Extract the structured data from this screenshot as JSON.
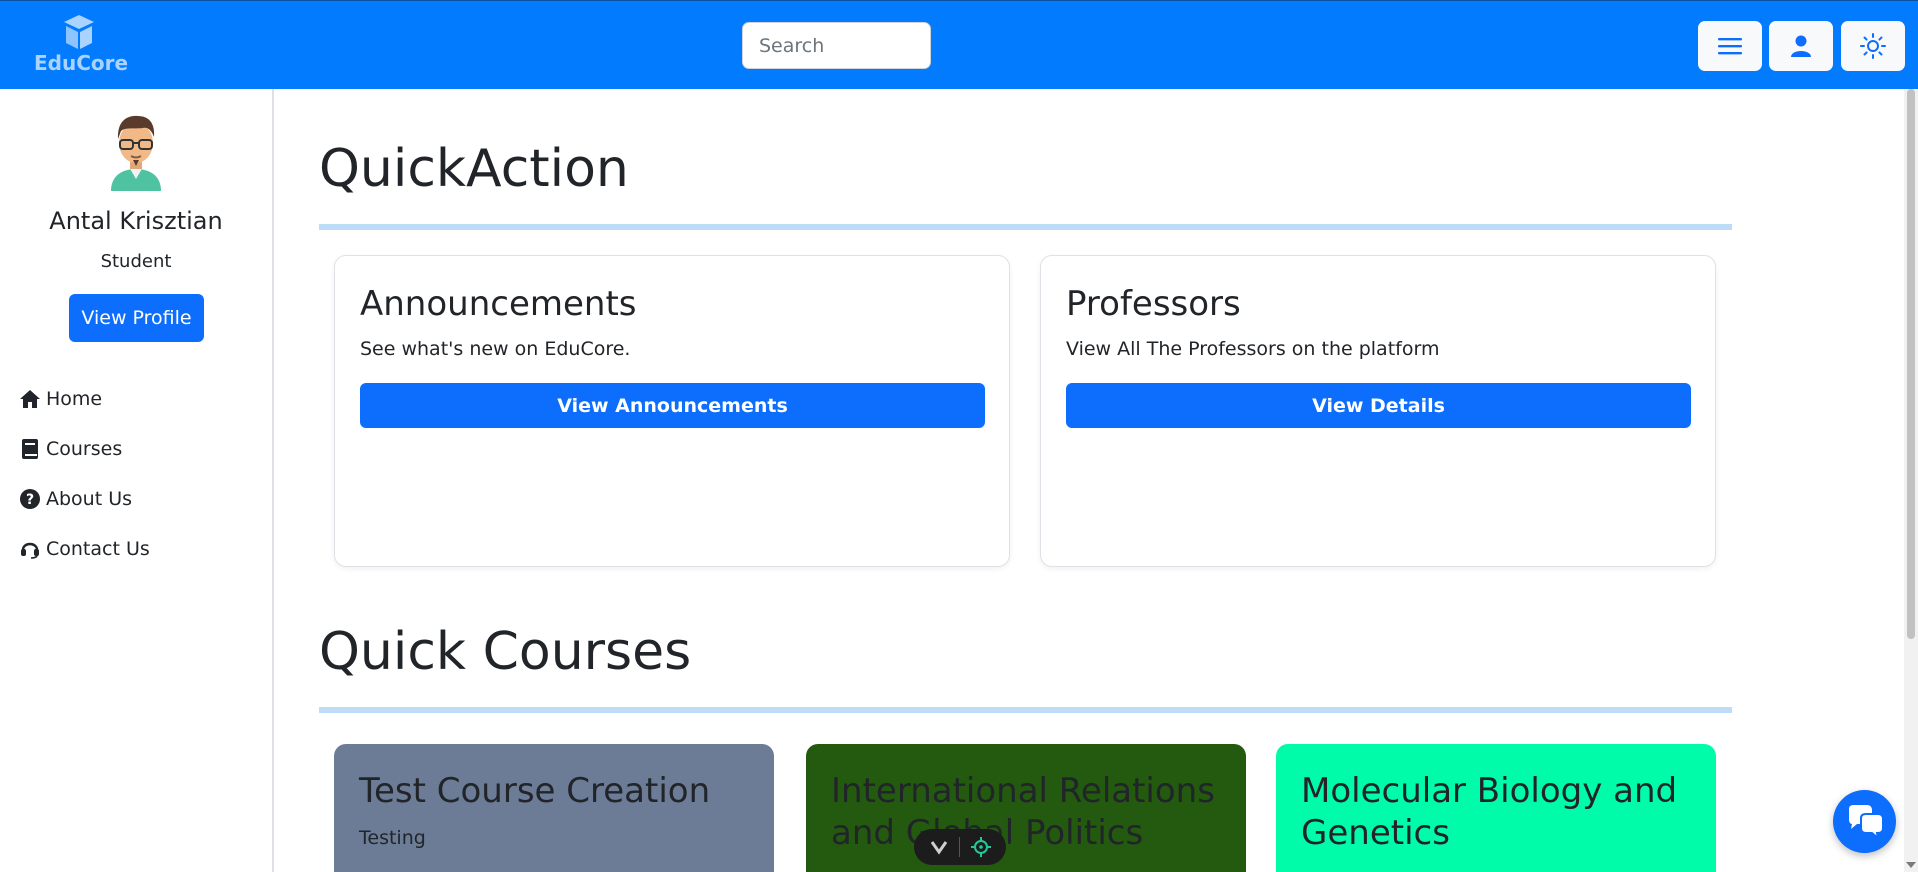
{
  "brand": {
    "name": "EduCore",
    "logo_icon": "graduation-cube-icon"
  },
  "header": {
    "search_placeholder": "Search",
    "buttons": [
      {
        "name": "menu-button",
        "icon": "hamburger-icon"
      },
      {
        "name": "user-button",
        "icon": "user-icon"
      },
      {
        "name": "theme-button",
        "icon": "sun-icon"
      }
    ]
  },
  "sidebar": {
    "user_name": "Antal Krisztian",
    "user_role": "Student",
    "view_profile_label": "View Profile",
    "nav": [
      {
        "label": "Home",
        "icon": "home-icon"
      },
      {
        "label": "Courses",
        "icon": "book-icon"
      },
      {
        "label": "About Us",
        "icon": "question-circle-icon"
      },
      {
        "label": "Contact Us",
        "icon": "headset-icon"
      }
    ]
  },
  "main": {
    "quick_action_title": "QuickAction",
    "cards": [
      {
        "title": "Announcements",
        "text": "See what's new on EduCore.",
        "button": "View Announcements"
      },
      {
        "title": "Professors",
        "text": "View All The Professors on the platform",
        "button": "View Details"
      }
    ],
    "quick_courses_title": "Quick Courses",
    "courses": [
      {
        "title": "Test Course Creation",
        "description": "Testing",
        "color": "#6c7c96"
      },
      {
        "title": "International Relations and Global Politics",
        "description": "",
        "color": "#235a10"
      },
      {
        "title": "Molecular Biology and Genetics",
        "description": "",
        "color": "#00fca8"
      }
    ]
  },
  "colors": {
    "primary": "#037bff",
    "button": "#0d6efd",
    "divider": "#bcdcf8"
  }
}
